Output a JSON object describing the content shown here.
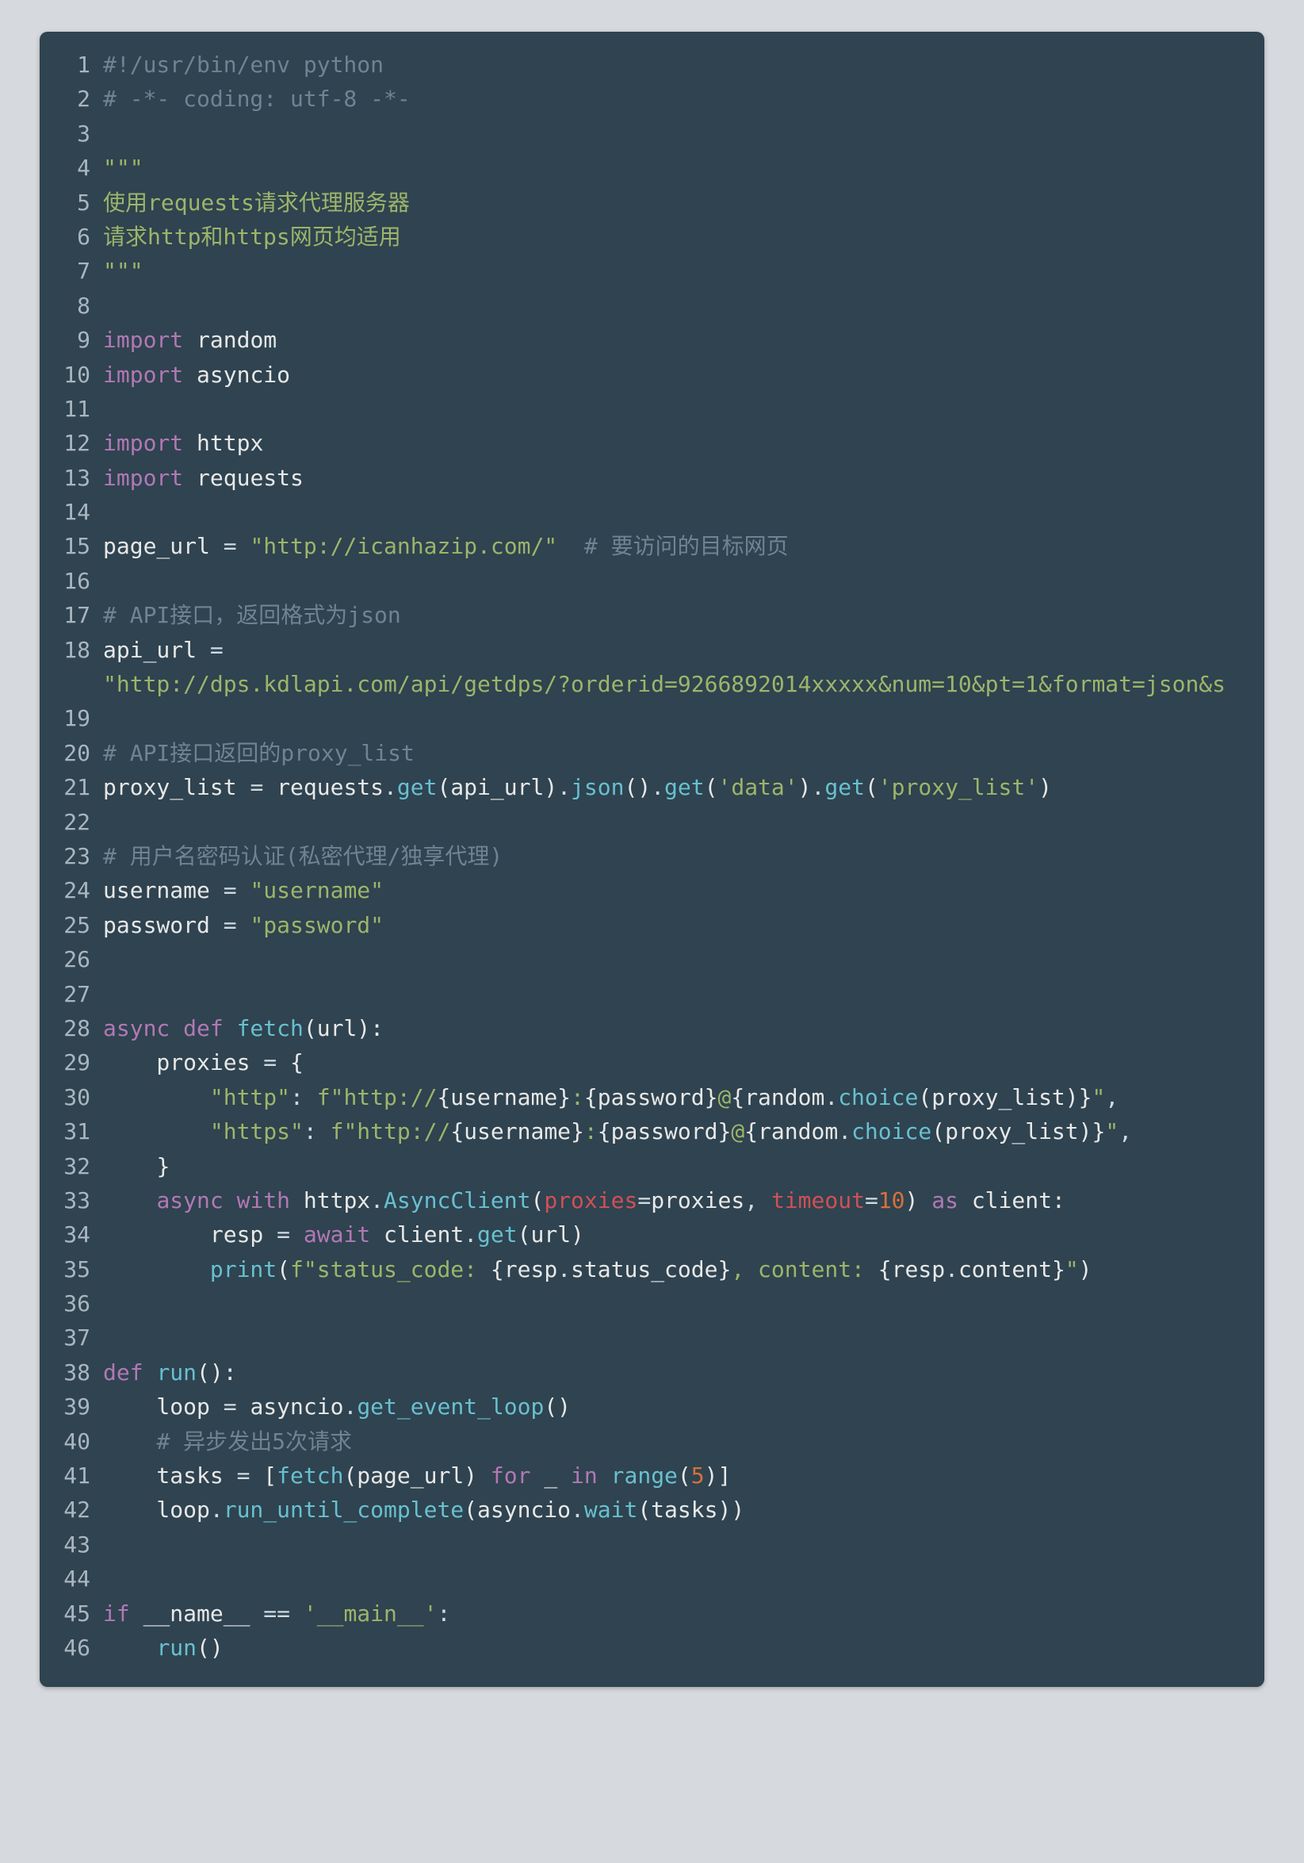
{
  "lines": [
    {
      "n": 1,
      "segments": [
        {
          "c": "tok-cmt",
          "t": "#!/usr/bin/env python"
        }
      ]
    },
    {
      "n": 2,
      "segments": [
        {
          "c": "tok-cmt",
          "t": "# -*- coding: utf-8 -*-"
        }
      ]
    },
    {
      "n": 3,
      "segments": []
    },
    {
      "n": 4,
      "segments": [
        {
          "c": "tok-str",
          "t": "\"\"\""
        }
      ]
    },
    {
      "n": 5,
      "segments": [
        {
          "c": "tok-str",
          "t": "使用requests请求代理服务器"
        }
      ]
    },
    {
      "n": 6,
      "segments": [
        {
          "c": "tok-str",
          "t": "请求http和https网页均适用"
        }
      ]
    },
    {
      "n": 7,
      "segments": [
        {
          "c": "tok-str",
          "t": "\"\"\""
        }
      ]
    },
    {
      "n": 8,
      "segments": []
    },
    {
      "n": 9,
      "segments": [
        {
          "c": "tok-kw",
          "t": "import"
        },
        {
          "c": "tok-id",
          "t": " random"
        }
      ]
    },
    {
      "n": 10,
      "segments": [
        {
          "c": "tok-kw",
          "t": "import"
        },
        {
          "c": "tok-id",
          "t": " asyncio"
        }
      ]
    },
    {
      "n": 11,
      "segments": []
    },
    {
      "n": 12,
      "segments": [
        {
          "c": "tok-kw",
          "t": "import"
        },
        {
          "c": "tok-id",
          "t": " httpx"
        }
      ]
    },
    {
      "n": 13,
      "segments": [
        {
          "c": "tok-kw",
          "t": "import"
        },
        {
          "c": "tok-id",
          "t": " requests"
        }
      ]
    },
    {
      "n": 14,
      "segments": []
    },
    {
      "n": 15,
      "segments": [
        {
          "c": "tok-id",
          "t": "page_url "
        },
        {
          "c": "tok-op",
          "t": "= "
        },
        {
          "c": "tok-str",
          "t": "\"http://icanhazip.com/\""
        },
        {
          "c": "tok-id",
          "t": "  "
        },
        {
          "c": "tok-cmt",
          "t": "# 要访问的目标网页"
        }
      ]
    },
    {
      "n": 16,
      "segments": []
    },
    {
      "n": 17,
      "segments": [
        {
          "c": "tok-cmt",
          "t": "# API接口，返回格式为json"
        }
      ]
    },
    {
      "n": 18,
      "segments": [
        {
          "c": "tok-id",
          "t": "api_url "
        },
        {
          "c": "tok-op",
          "t": "="
        }
      ]
    },
    {
      "n": 18,
      "cont": true,
      "segments": [
        {
          "c": "tok-str",
          "t": "\"http://dps.kdlapi.com/api/getdps/?orderid=9266892014xxxxx&num=10&pt=1&format=json&s"
        }
      ]
    },
    {
      "n": 19,
      "segments": []
    },
    {
      "n": 20,
      "segments": [
        {
          "c": "tok-cmt",
          "t": "# API接口返回的proxy_list"
        }
      ]
    },
    {
      "n": 21,
      "segments": [
        {
          "c": "tok-id",
          "t": "proxy_list "
        },
        {
          "c": "tok-op",
          "t": "= "
        },
        {
          "c": "tok-id",
          "t": "requests"
        },
        {
          "c": "tok-op",
          "t": "."
        },
        {
          "c": "tok-call",
          "t": "get"
        },
        {
          "c": "tok-paren",
          "t": "(api_url)"
        },
        {
          "c": "tok-op",
          "t": "."
        },
        {
          "c": "tok-call",
          "t": "json"
        },
        {
          "c": "tok-paren",
          "t": "()"
        },
        {
          "c": "tok-op",
          "t": "."
        },
        {
          "c": "tok-call",
          "t": "get"
        },
        {
          "c": "tok-paren",
          "t": "("
        },
        {
          "c": "tok-str",
          "t": "'data'"
        },
        {
          "c": "tok-paren",
          "t": ")"
        },
        {
          "c": "tok-op",
          "t": "."
        },
        {
          "c": "tok-call",
          "t": "get"
        },
        {
          "c": "tok-paren",
          "t": "("
        },
        {
          "c": "tok-str",
          "t": "'proxy_list'"
        },
        {
          "c": "tok-paren",
          "t": ")"
        }
      ]
    },
    {
      "n": 22,
      "segments": []
    },
    {
      "n": 23,
      "segments": [
        {
          "c": "tok-cmt",
          "t": "# 用户名密码认证(私密代理/独享代理)"
        }
      ]
    },
    {
      "n": 24,
      "segments": [
        {
          "c": "tok-id",
          "t": "username "
        },
        {
          "c": "tok-op",
          "t": "= "
        },
        {
          "c": "tok-str",
          "t": "\"username\""
        }
      ]
    },
    {
      "n": 25,
      "segments": [
        {
          "c": "tok-id",
          "t": "password "
        },
        {
          "c": "tok-op",
          "t": "= "
        },
        {
          "c": "tok-str",
          "t": "\"password\""
        }
      ]
    },
    {
      "n": 26,
      "segments": []
    },
    {
      "n": 27,
      "segments": []
    },
    {
      "n": 28,
      "segments": [
        {
          "c": "tok-kw",
          "t": "async def "
        },
        {
          "c": "tok-def",
          "t": "fetch"
        },
        {
          "c": "tok-paren",
          "t": "(url):"
        }
      ]
    },
    {
      "n": 29,
      "segments": [
        {
          "c": "tok-id",
          "t": "    proxies "
        },
        {
          "c": "tok-op",
          "t": "= "
        },
        {
          "c": "tok-paren",
          "t": "{"
        }
      ]
    },
    {
      "n": 30,
      "segments": [
        {
          "c": "tok-id",
          "t": "        "
        },
        {
          "c": "tok-str",
          "t": "\"http\""
        },
        {
          "c": "tok-op",
          "t": ": "
        },
        {
          "c": "tok-str",
          "t": "f\"http://"
        },
        {
          "c": "tok-paren",
          "t": "{username}"
        },
        {
          "c": "tok-str",
          "t": ":"
        },
        {
          "c": "tok-paren",
          "t": "{password}"
        },
        {
          "c": "tok-str",
          "t": "@"
        },
        {
          "c": "tok-paren",
          "t": "{"
        },
        {
          "c": "tok-id",
          "t": "random"
        },
        {
          "c": "tok-op",
          "t": "."
        },
        {
          "c": "tok-call",
          "t": "choice"
        },
        {
          "c": "tok-paren",
          "t": "(proxy_list)}"
        },
        {
          "c": "tok-str",
          "t": "\""
        },
        {
          "c": "tok-op",
          "t": ","
        }
      ]
    },
    {
      "n": 31,
      "segments": [
        {
          "c": "tok-id",
          "t": "        "
        },
        {
          "c": "tok-str",
          "t": "\"https\""
        },
        {
          "c": "tok-op",
          "t": ": "
        },
        {
          "c": "tok-str",
          "t": "f\"http://"
        },
        {
          "c": "tok-paren",
          "t": "{username}"
        },
        {
          "c": "tok-str",
          "t": ":"
        },
        {
          "c": "tok-paren",
          "t": "{password}"
        },
        {
          "c": "tok-str",
          "t": "@"
        },
        {
          "c": "tok-paren",
          "t": "{"
        },
        {
          "c": "tok-id",
          "t": "random"
        },
        {
          "c": "tok-op",
          "t": "."
        },
        {
          "c": "tok-call",
          "t": "choice"
        },
        {
          "c": "tok-paren",
          "t": "(proxy_list)}"
        },
        {
          "c": "tok-str",
          "t": "\""
        },
        {
          "c": "tok-op",
          "t": ","
        }
      ]
    },
    {
      "n": 32,
      "segments": [
        {
          "c": "tok-id",
          "t": "    "
        },
        {
          "c": "tok-paren",
          "t": "}"
        }
      ]
    },
    {
      "n": 33,
      "segments": [
        {
          "c": "tok-id",
          "t": "    "
        },
        {
          "c": "tok-kw",
          "t": "async with"
        },
        {
          "c": "tok-id",
          "t": " httpx"
        },
        {
          "c": "tok-op",
          "t": "."
        },
        {
          "c": "tok-call",
          "t": "AsyncClient"
        },
        {
          "c": "tok-paren",
          "t": "("
        },
        {
          "c": "tok-red",
          "t": "proxies"
        },
        {
          "c": "tok-op",
          "t": "="
        },
        {
          "c": "tok-id",
          "t": "proxies"
        },
        {
          "c": "tok-op",
          "t": ", "
        },
        {
          "c": "tok-red",
          "t": "timeout"
        },
        {
          "c": "tok-op",
          "t": "="
        },
        {
          "c": "tok-num",
          "t": "10"
        },
        {
          "c": "tok-paren",
          "t": ")"
        },
        {
          "c": "tok-id",
          "t": " "
        },
        {
          "c": "tok-kw",
          "t": "as"
        },
        {
          "c": "tok-id",
          "t": " client:"
        }
      ]
    },
    {
      "n": 34,
      "segments": [
        {
          "c": "tok-id",
          "t": "        resp "
        },
        {
          "c": "tok-op",
          "t": "= "
        },
        {
          "c": "tok-kw",
          "t": "await"
        },
        {
          "c": "tok-id",
          "t": " client"
        },
        {
          "c": "tok-op",
          "t": "."
        },
        {
          "c": "tok-call",
          "t": "get"
        },
        {
          "c": "tok-paren",
          "t": "(url)"
        }
      ]
    },
    {
      "n": 35,
      "segments": [
        {
          "c": "tok-id",
          "t": "        "
        },
        {
          "c": "tok-call",
          "t": "print"
        },
        {
          "c": "tok-paren",
          "t": "("
        },
        {
          "c": "tok-str",
          "t": "f\"status_code: "
        },
        {
          "c": "tok-paren",
          "t": "{"
        },
        {
          "c": "tok-id",
          "t": "resp"
        },
        {
          "c": "tok-op",
          "t": "."
        },
        {
          "c": "tok-id",
          "t": "status_code"
        },
        {
          "c": "tok-paren",
          "t": "}"
        },
        {
          "c": "tok-str",
          "t": ", content: "
        },
        {
          "c": "tok-paren",
          "t": "{"
        },
        {
          "c": "tok-id",
          "t": "resp"
        },
        {
          "c": "tok-op",
          "t": "."
        },
        {
          "c": "tok-id",
          "t": "content"
        },
        {
          "c": "tok-paren",
          "t": "}"
        },
        {
          "c": "tok-str",
          "t": "\""
        },
        {
          "c": "tok-paren",
          "t": ")"
        }
      ]
    },
    {
      "n": 36,
      "segments": []
    },
    {
      "n": 37,
      "segments": []
    },
    {
      "n": 38,
      "segments": [
        {
          "c": "tok-kw",
          "t": "def "
        },
        {
          "c": "tok-def",
          "t": "run"
        },
        {
          "c": "tok-paren",
          "t": "():"
        }
      ]
    },
    {
      "n": 39,
      "segments": [
        {
          "c": "tok-id",
          "t": "    loop "
        },
        {
          "c": "tok-op",
          "t": "= "
        },
        {
          "c": "tok-id",
          "t": "asyncio"
        },
        {
          "c": "tok-op",
          "t": "."
        },
        {
          "c": "tok-call",
          "t": "get_event_loop"
        },
        {
          "c": "tok-paren",
          "t": "()"
        }
      ]
    },
    {
      "n": 40,
      "segments": [
        {
          "c": "tok-id",
          "t": "    "
        },
        {
          "c": "tok-cmt",
          "t": "# 异步发出5次请求"
        }
      ]
    },
    {
      "n": 41,
      "segments": [
        {
          "c": "tok-id",
          "t": "    tasks "
        },
        {
          "c": "tok-op",
          "t": "= "
        },
        {
          "c": "tok-paren",
          "t": "["
        },
        {
          "c": "tok-call",
          "t": "fetch"
        },
        {
          "c": "tok-paren",
          "t": "(page_url) "
        },
        {
          "c": "tok-kw",
          "t": "for"
        },
        {
          "c": "tok-id",
          "t": " _ "
        },
        {
          "c": "tok-kw",
          "t": "in "
        },
        {
          "c": "tok-call",
          "t": "range"
        },
        {
          "c": "tok-paren",
          "t": "("
        },
        {
          "c": "tok-num",
          "t": "5"
        },
        {
          "c": "tok-paren",
          "t": ")]"
        }
      ]
    },
    {
      "n": 42,
      "segments": [
        {
          "c": "tok-id",
          "t": "    loop"
        },
        {
          "c": "tok-op",
          "t": "."
        },
        {
          "c": "tok-call",
          "t": "run_until_complete"
        },
        {
          "c": "tok-paren",
          "t": "("
        },
        {
          "c": "tok-id",
          "t": "asyncio"
        },
        {
          "c": "tok-op",
          "t": "."
        },
        {
          "c": "tok-call",
          "t": "wait"
        },
        {
          "c": "tok-paren",
          "t": "(tasks))"
        }
      ]
    },
    {
      "n": 43,
      "segments": []
    },
    {
      "n": 44,
      "segments": []
    },
    {
      "n": 45,
      "segments": [
        {
          "c": "tok-kw",
          "t": "if"
        },
        {
          "c": "tok-id",
          "t": " __name__ "
        },
        {
          "c": "tok-op",
          "t": "== "
        },
        {
          "c": "tok-str",
          "t": "'__main__'"
        },
        {
          "c": "tok-op",
          "t": ":"
        }
      ]
    },
    {
      "n": 46,
      "segments": [
        {
          "c": "tok-id",
          "t": "    "
        },
        {
          "c": "tok-call",
          "t": "run"
        },
        {
          "c": "tok-paren",
          "t": "()"
        }
      ]
    }
  ]
}
